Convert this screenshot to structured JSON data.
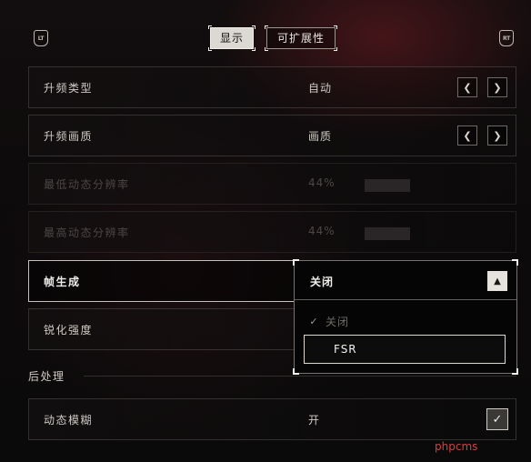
{
  "header": {
    "left_trigger": "LT",
    "right_trigger": "RT",
    "tabs": [
      {
        "label": "显示",
        "active": true
      },
      {
        "label": "可扩展性",
        "active": false
      }
    ]
  },
  "settings": [
    {
      "label": "升频类型",
      "value": "自动",
      "control": "arrows"
    },
    {
      "label": "升频画质",
      "value": "画质",
      "control": "arrows"
    },
    {
      "label": "最低动态分辨率",
      "value": "44%",
      "control": "slider",
      "disabled": true
    },
    {
      "label": "最高动态分辨率",
      "value": "44%",
      "control": "slider",
      "disabled": true
    },
    {
      "label": "帧生成",
      "value": "关闭",
      "control": "dropdown",
      "focused": true
    },
    {
      "label": "锐化强度",
      "value": "",
      "control": "slider"
    }
  ],
  "section_postprocess": {
    "title": "后处理",
    "items": [
      {
        "label": "动态模糊",
        "value": "开",
        "control": "checkbox",
        "checked": true
      }
    ]
  },
  "dropdown": {
    "selected": "关闭",
    "options": [
      {
        "label": "关闭",
        "checked": true
      },
      {
        "label": "FSR",
        "highlighted": true
      }
    ]
  },
  "watermark": "phpcms",
  "icons": {
    "arrow_left": "chevron-left-icon",
    "arrow_right": "chevron-right-icon",
    "collapse": "chevron-up-icon",
    "check": "check-icon"
  }
}
